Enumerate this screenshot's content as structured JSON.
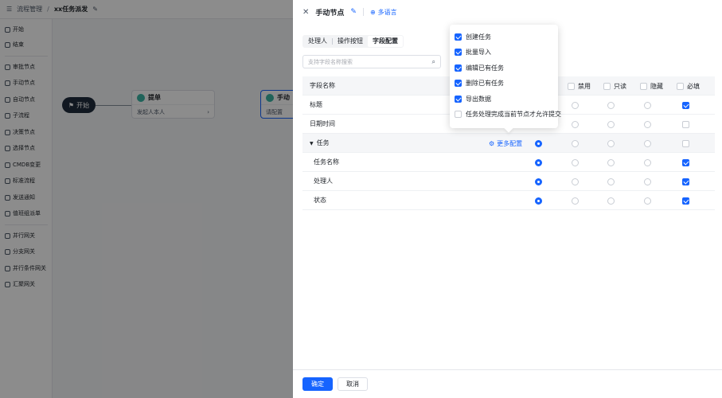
{
  "topbar": {
    "crumb": "流程管理",
    "title": "xx任务派发"
  },
  "sidebar": {
    "items": [
      {
        "label": "开始"
      },
      {
        "label": "结束"
      },
      {
        "label": "审批节点"
      },
      {
        "label": "手动节点"
      },
      {
        "label": "自动节点"
      },
      {
        "label": "子流程"
      },
      {
        "label": "决策节点"
      },
      {
        "label": "选择节点"
      },
      {
        "label": "CMDB变更"
      },
      {
        "label": "标准流程"
      },
      {
        "label": "发送通知"
      },
      {
        "label": "值班组派单"
      },
      {
        "label": "并行网关"
      },
      {
        "label": "分支网关"
      },
      {
        "label": "并行条件网关"
      },
      {
        "label": "汇聚网关"
      }
    ]
  },
  "canvas": {
    "start_label": "开始",
    "node1": {
      "title": "提单",
      "body": "发起人本人"
    },
    "node2": {
      "title": "手动",
      "body": "请配置"
    }
  },
  "drawer": {
    "title": "手动节点",
    "lang_label": "多语言",
    "tabs": [
      {
        "label": "处理人"
      },
      {
        "label": "操作按钮"
      },
      {
        "label": "字段配置"
      }
    ],
    "search_placeholder": "支持字段名称搜索",
    "table": {
      "header_name": "字段名称",
      "cols": [
        {
          "label": "禁用"
        },
        {
          "label": "只读"
        },
        {
          "label": "隐藏"
        },
        {
          "label": "必填"
        }
      ],
      "more_config": "更多配置",
      "rows": [
        {
          "name": "标题",
          "required": true
        },
        {
          "name": "日期时间",
          "required": false
        },
        {
          "name": "任务",
          "required": false
        },
        {
          "name": "任务名称",
          "required": true
        },
        {
          "name": "处理人",
          "required": true
        },
        {
          "name": "状态",
          "required": true
        }
      ]
    },
    "popover": {
      "items": [
        {
          "label": "创建任务",
          "checked": true
        },
        {
          "label": "批量导入",
          "checked": true
        },
        {
          "label": "编辑已有任务",
          "checked": true
        },
        {
          "label": "删除已有任务",
          "checked": true
        },
        {
          "label": "导出数据",
          "checked": true
        },
        {
          "label": "任务处理完成当前节点才允许提交",
          "checked": false
        }
      ]
    },
    "footer": {
      "confirm": "确定",
      "cancel": "取消"
    }
  },
  "colors": {
    "primary": "#1664ff",
    "overlay": "rgba(0,0,0,0.45)",
    "node_dark": "#1f2d3d"
  }
}
